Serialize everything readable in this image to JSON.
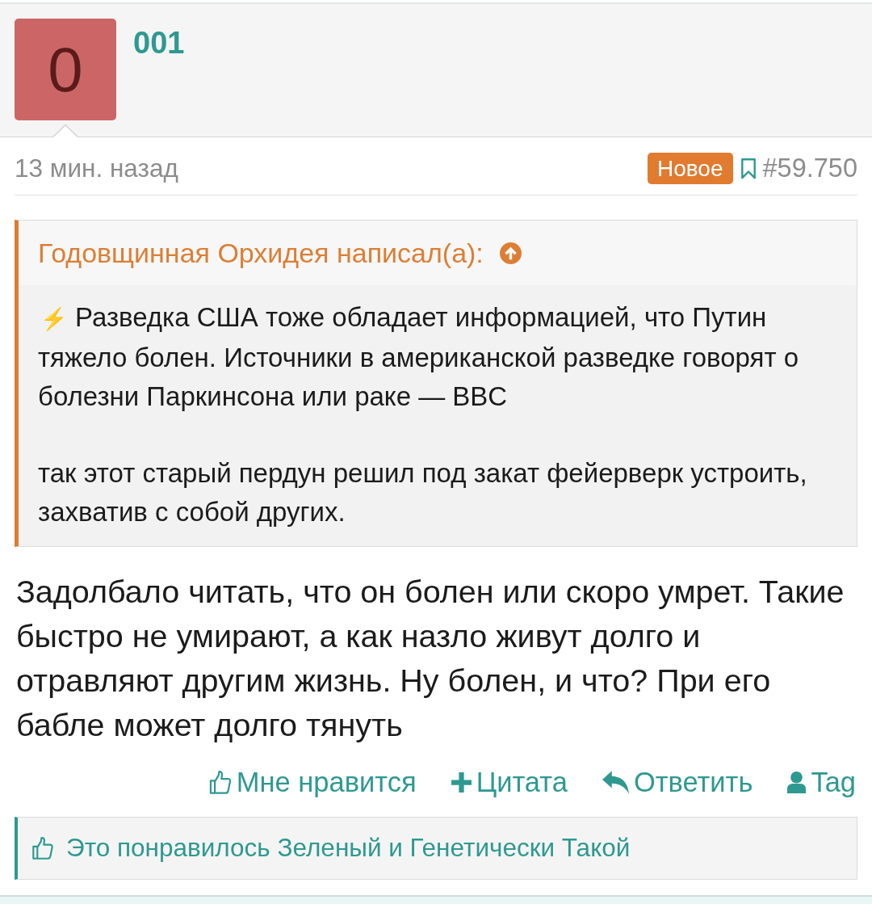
{
  "post": {
    "author": {
      "name": "001",
      "avatar_letter": "0"
    },
    "time": "13 мин. назад",
    "badge": "Новое",
    "bookmarked": false,
    "number": "#59.750",
    "quote": {
      "header": "Годовщинная Орхидея написал(а):",
      "paragraphs": [
        {
          "emoji": "⚡",
          "text": "Разведка США тоже обладает информацией, что Путин тяжело болен. Источники в американской разведке говорят о болезни Паркинсона или раке — BBC"
        },
        {
          "text": "так этот старый пердун решил под закат фейерверк устроить, захватив с собой других."
        }
      ]
    },
    "body": "Задолбало читать, что он болен или скоро умрет. Такие быстро не умирают, а как назло живут долго и отравляют другим жизнь. Ну болен, и что? При его бабле может долго тянуть",
    "actions": [
      {
        "kind": "like",
        "label": "Мне нравится"
      },
      {
        "kind": "quote",
        "label": "Цитата"
      },
      {
        "kind": "reply",
        "label": "Ответить"
      },
      {
        "kind": "tag",
        "label": "Tag"
      }
    ],
    "likes": "Это понравилось Зеленый и Генетически Такой"
  }
}
